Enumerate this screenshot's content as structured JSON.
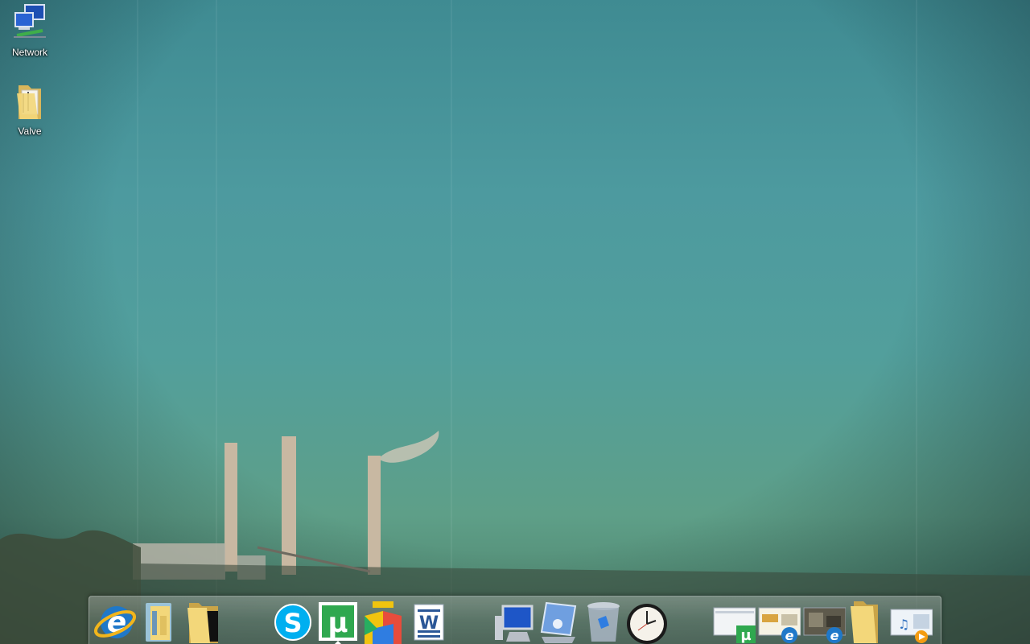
{
  "desktop": {
    "icons": [
      {
        "label": "Network",
        "icon": "network-icon"
      },
      {
        "label": "Valve",
        "icon": "folder-icon"
      }
    ]
  },
  "dock": {
    "items": [
      {
        "name": "internet-explorer",
        "icon": "internet-explorer-icon",
        "glyph": "e"
      },
      {
        "name": "file-manager",
        "icon": "file-manager-icon"
      },
      {
        "name": "folder-dark",
        "icon": "folder-icon"
      },
      {
        "name": "skype",
        "icon": "skype-icon",
        "glyph": "S"
      },
      {
        "name": "utorrent",
        "icon": "utorrent-icon",
        "glyph": "µ",
        "running": true
      },
      {
        "name": "avg",
        "icon": "avg-antivirus-icon"
      },
      {
        "name": "word",
        "icon": "word-icon",
        "glyph": "W"
      },
      {
        "name": "computer",
        "icon": "computer-icon"
      },
      {
        "name": "network-connection",
        "icon": "network-connection-icon"
      },
      {
        "name": "recycle-bin",
        "icon": "recycle-bin-icon"
      },
      {
        "name": "clock",
        "icon": "clock-icon"
      },
      {
        "name": "utorrent-window",
        "icon": "window-thumbnail-icon",
        "glyph": "µ"
      },
      {
        "name": "ie-window-1",
        "icon": "window-thumbnail-icon",
        "glyph": "e"
      },
      {
        "name": "ie-window-2",
        "icon": "window-thumbnail-icon",
        "glyph": "e"
      },
      {
        "name": "folder-yellow",
        "icon": "folder-icon"
      },
      {
        "name": "media-player-window",
        "icon": "media-player-icon",
        "glyph": "♫"
      }
    ]
  },
  "colors": {
    "ie_blue": "#1f78c9",
    "ie_ring": "#f2b51c",
    "skype_blue": "#00aff0",
    "utorrent_green": "#2fa84f",
    "word_blue": "#2b5797",
    "folder_yellow": "#f3d77a"
  }
}
